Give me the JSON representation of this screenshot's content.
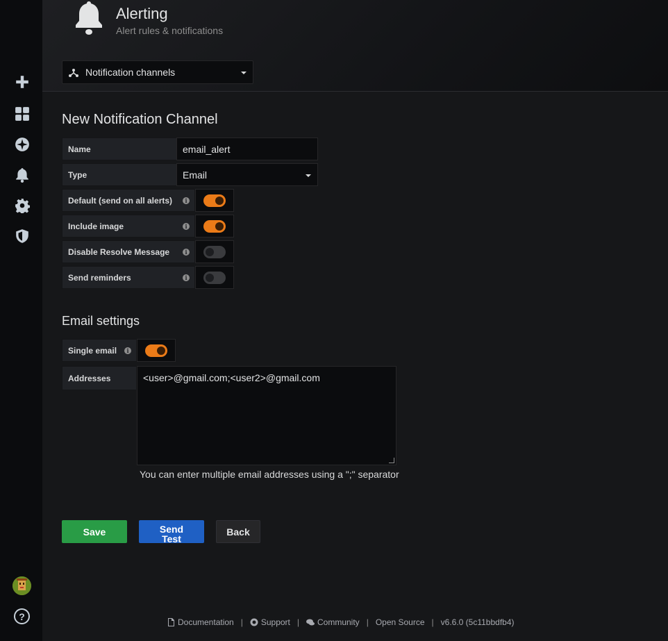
{
  "header": {
    "title": "Alerting",
    "subtitle": "Alert rules & notifications",
    "icon": "bell-icon",
    "nav_select": {
      "label": "Notification channels",
      "icon": "channels-icon"
    }
  },
  "sidebar": {
    "items": [
      {
        "name": "create",
        "icon": "plus-icon"
      },
      {
        "name": "dashboards",
        "icon": "dashboards-icon"
      },
      {
        "name": "explore",
        "icon": "compass-icon"
      },
      {
        "name": "alerting",
        "icon": "bell-icon"
      },
      {
        "name": "configuration",
        "icon": "gear-icon"
      },
      {
        "name": "server-admin",
        "icon": "shield-icon"
      }
    ],
    "bottom": {
      "avatar": "avatar",
      "help": "?"
    }
  },
  "form": {
    "title": "New Notification Channel",
    "name_label": "Name",
    "name_value": "email_alert",
    "type_label": "Type",
    "type_value": "Email",
    "toggles": [
      {
        "label": "Default (send on all alerts)",
        "on": true
      },
      {
        "label": "Include image",
        "on": true
      },
      {
        "label": "Disable Resolve Message",
        "on": false
      },
      {
        "label": "Send reminders",
        "on": false
      }
    ]
  },
  "email_settings": {
    "title": "Email settings",
    "single_email_label": "Single email",
    "single_email_on": true,
    "addresses_label": "Addresses",
    "addresses_value": "<user>@gmail.com;<user2>@gmail.com",
    "help": "You can enter multiple email addresses using a \";\" separator"
  },
  "buttons": {
    "save": "Save",
    "send_test": "Send Test",
    "back": "Back"
  },
  "footer": {
    "documentation": "Documentation",
    "support": "Support",
    "community": "Community",
    "open_source": "Open Source",
    "version": "v6.6.0 (5c11bbdfb4)",
    "separator": "|"
  },
  "colors": {
    "accent_orange": "#eb7b18",
    "save_green": "#299c46",
    "test_blue": "#1f60c4",
    "background": "#161719"
  }
}
